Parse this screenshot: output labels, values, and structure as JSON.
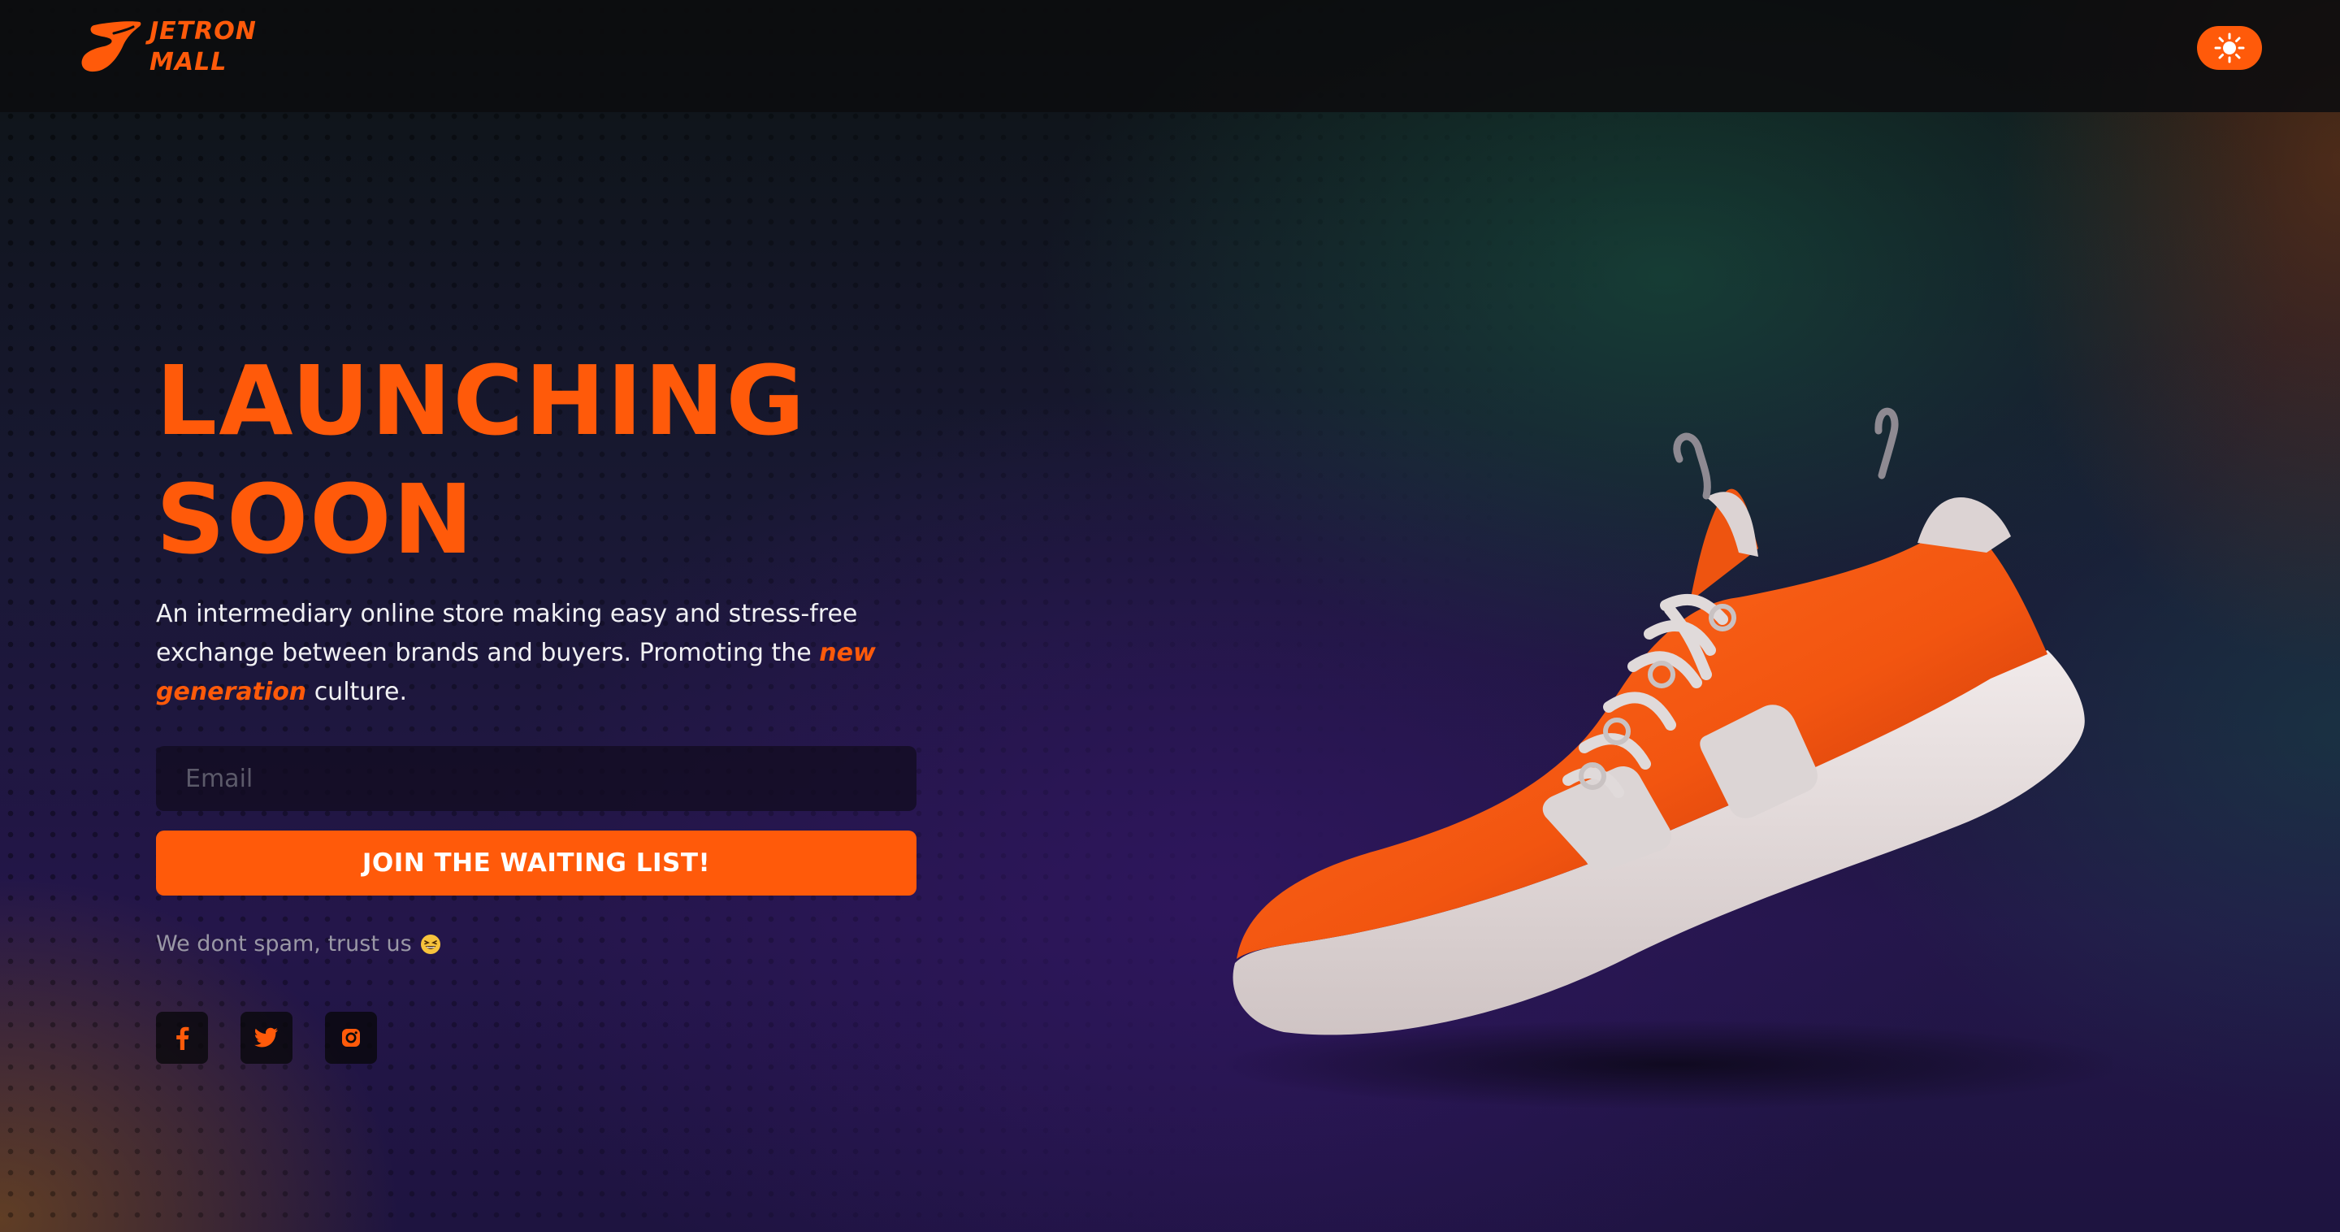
{
  "brand": {
    "name_line1": "JETRON",
    "name_line2": "MALL",
    "accent_color": "#ff5a0a"
  },
  "header": {
    "theme_toggle_icon": "sun-icon"
  },
  "hero": {
    "title_line1": "LAUNCHING",
    "title_line2": "SOON",
    "description_part1": "An intermediary online store making easy and stress-free exchange between brands and buyers. Promoting the ",
    "description_highlight": "new generation",
    "description_part2": " culture."
  },
  "form": {
    "email_placeholder": "Email",
    "email_value": "",
    "submit_label": "JOIN THE WAITING LIST!",
    "note": "We dont spam, trust us",
    "note_emoji": "grinning-squinting-face-emoji"
  },
  "socials": [
    {
      "icon": "facebook-icon"
    },
    {
      "icon": "twitter-icon"
    },
    {
      "icon": "instagram-icon"
    }
  ],
  "hero_image": {
    "icon": "orange-sneaker-illustration"
  }
}
